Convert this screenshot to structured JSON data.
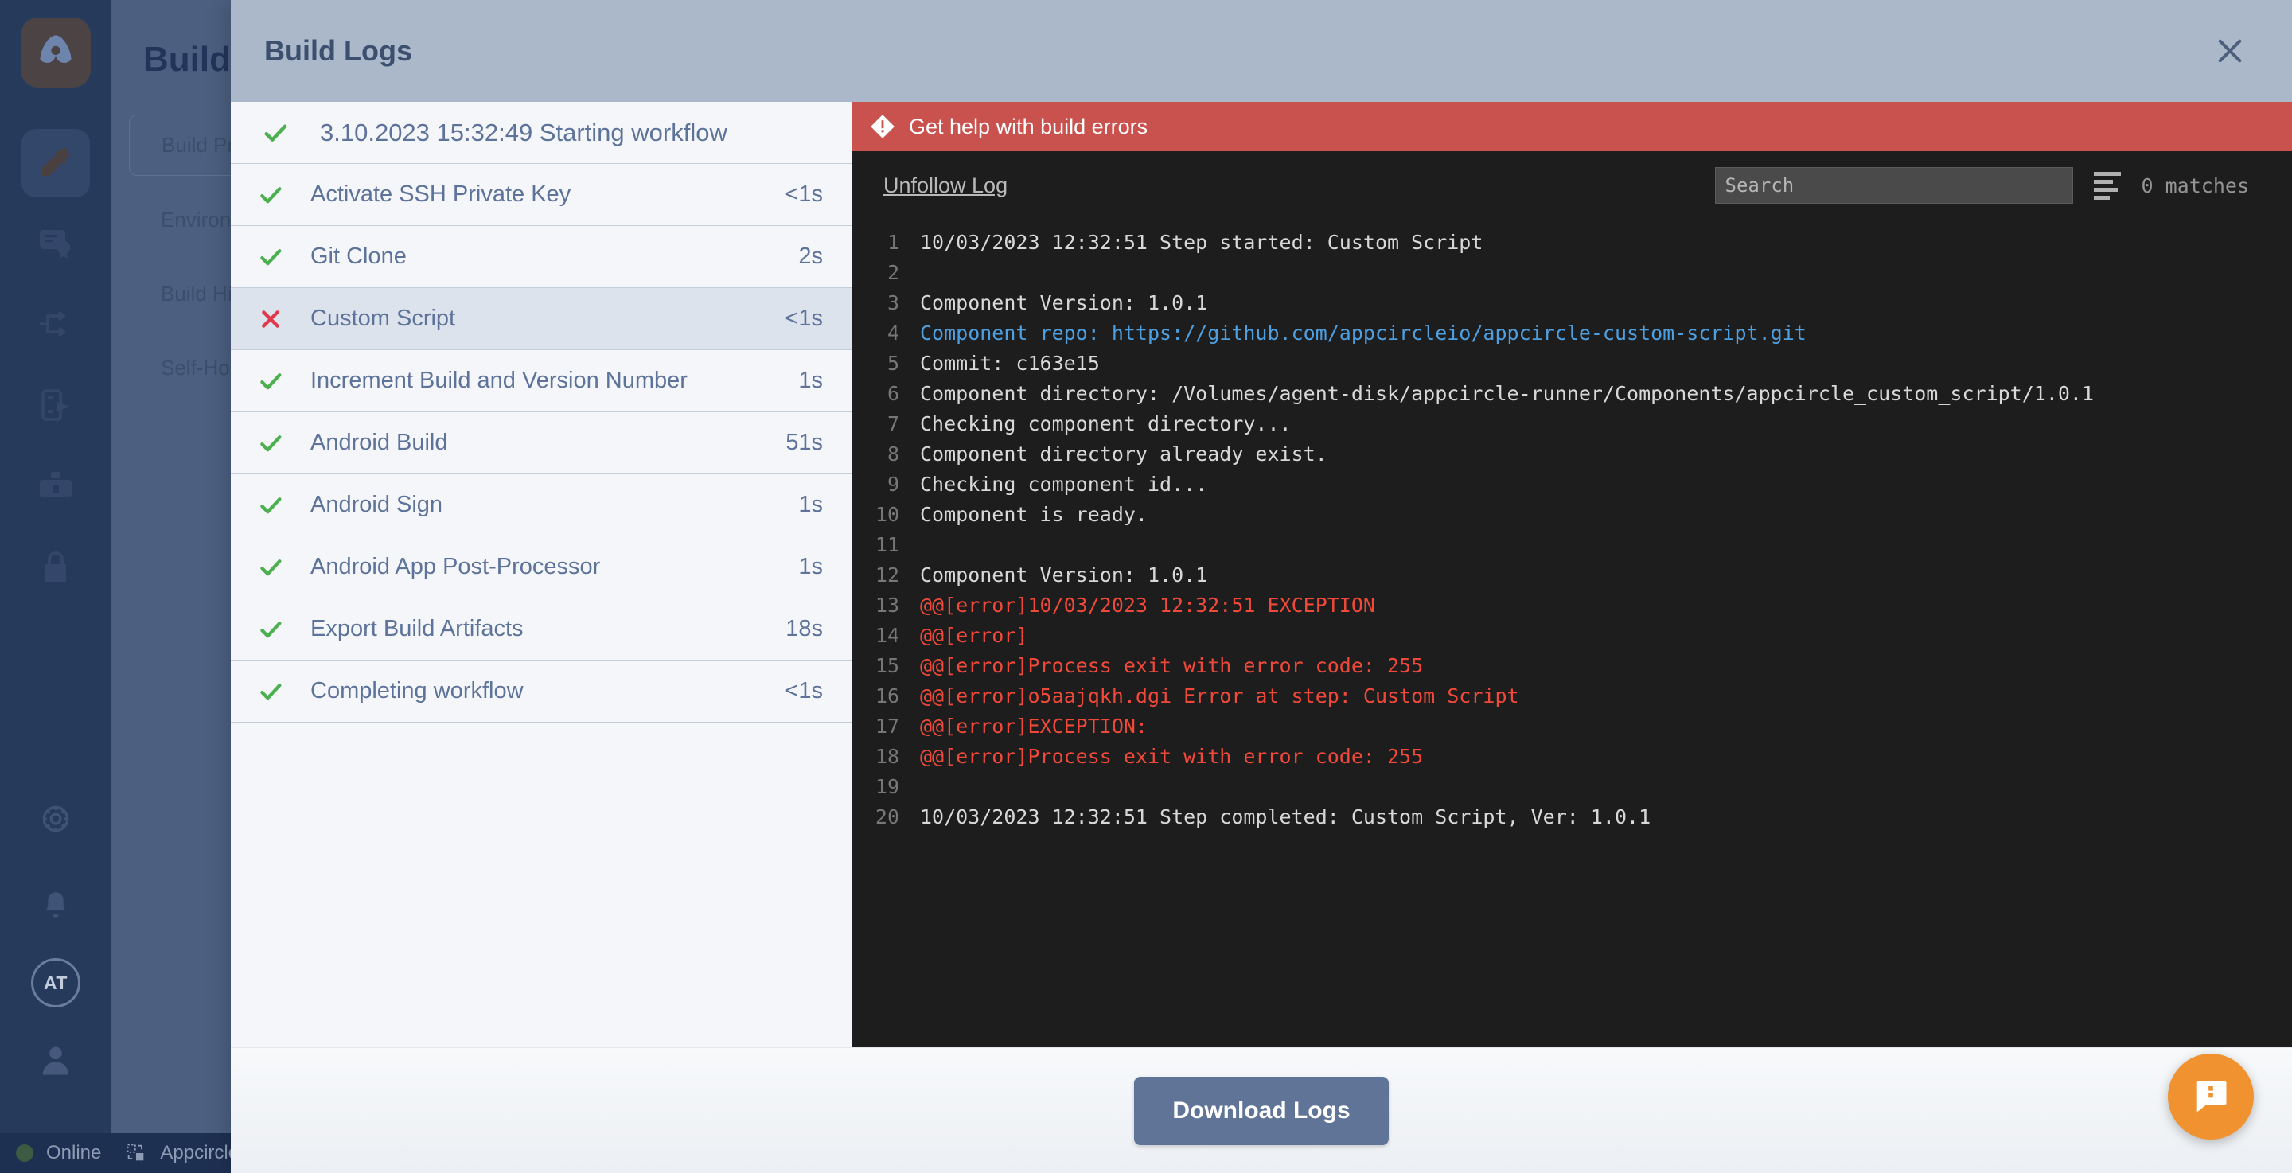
{
  "app": {
    "rail": {
      "logo_icon": "appcircle-logo-icon",
      "items": [
        {
          "icon": "hammer-icon",
          "active": true
        },
        {
          "icon": "certificate-icon",
          "active": false
        },
        {
          "icon": "distribute-icon",
          "active": false
        },
        {
          "icon": "testing-distribution-icon",
          "active": false
        },
        {
          "icon": "enterprise-store-icon",
          "active": false
        },
        {
          "icon": "lock-icon",
          "active": false
        }
      ],
      "bottom_items": [
        {
          "icon": "settings-gear-icon"
        },
        {
          "icon": "notification-bell-icon"
        }
      ],
      "avatar_initials": "AT",
      "profile_icon": "user-circle-icon"
    },
    "status_bar": {
      "connection_label": "Online",
      "connection_color": "#3d5a43",
      "org_icon": "appcircle-mark-icon",
      "org_label": "Appcircle"
    },
    "secondary_nav": {
      "title": "Build",
      "items": [
        {
          "label": "Build Profiles",
          "active": true
        },
        {
          "label": "Environment Variables",
          "active": false
        },
        {
          "label": "Build History",
          "active": false
        },
        {
          "label": "Self-Hosted Runners",
          "active": false
        }
      ]
    }
  },
  "modal": {
    "title": "Build Logs",
    "close_icon": "close-icon",
    "workflow_header": {
      "status": "ok",
      "status_icon": "check-icon",
      "label": "3.10.2023 15:32:49 Starting workflow",
      "duration": ""
    },
    "steps": [
      {
        "status": "ok",
        "status_icon": "check-icon",
        "label": "Activate SSH Private Key",
        "duration": "<1s",
        "selected": false
      },
      {
        "status": "ok",
        "status_icon": "check-icon",
        "label": "Git Clone",
        "duration": "2s",
        "selected": false
      },
      {
        "status": "bad",
        "status_icon": "cross-icon",
        "label": "Custom Script",
        "duration": "<1s",
        "selected": true
      },
      {
        "status": "ok",
        "status_icon": "check-icon",
        "label": "Increment Build and Version Number",
        "duration": "1s",
        "selected": false
      },
      {
        "status": "ok",
        "status_icon": "check-icon",
        "label": "Android Build",
        "duration": "51s",
        "selected": false
      },
      {
        "status": "ok",
        "status_icon": "check-icon",
        "label": "Android Sign",
        "duration": "1s",
        "selected": false
      },
      {
        "status": "ok",
        "status_icon": "check-icon",
        "label": "Android App Post-Processor",
        "duration": "1s",
        "selected": false
      },
      {
        "status": "ok",
        "status_icon": "check-icon",
        "label": "Export Build Artifacts",
        "duration": "18s",
        "selected": false
      },
      {
        "status": "ok",
        "status_icon": "check-icon",
        "label": "Completing workflow",
        "duration": "<1s",
        "selected": false
      }
    ],
    "error_banner": {
      "icon": "error-alert-icon",
      "text": "Get help with build errors",
      "color": "#c9524e"
    },
    "log_toolbar": {
      "follow_toggle_label": "Unfollow Log",
      "search_placeholder": "Search",
      "search_value": "",
      "wrap_icon": "text-wrap-icon",
      "matches_label": "0 matches"
    },
    "log_lines": [
      {
        "n": "1",
        "text": "10/03/2023 12:32:51 Step started: Custom Script",
        "kind": "plain"
      },
      {
        "n": "2",
        "text": "",
        "kind": "plain"
      },
      {
        "n": "3",
        "text": "Component Version: 1.0.1",
        "kind": "plain"
      },
      {
        "n": "4",
        "text": "Component repo: https://github.com/appcircleio/appcircle-custom-script.git",
        "kind": "link"
      },
      {
        "n": "5",
        "text": "Commit: c163e15",
        "kind": "plain"
      },
      {
        "n": "6",
        "text": "Component directory: /Volumes/agent-disk/appcircle-runner/Components/appcircle_custom_script/1.0.1",
        "kind": "plain"
      },
      {
        "n": "7",
        "text": "Checking component directory...",
        "kind": "plain"
      },
      {
        "n": "8",
        "text": "Component directory already exist.",
        "kind": "plain"
      },
      {
        "n": "9",
        "text": "Checking component id...",
        "kind": "plain"
      },
      {
        "n": "10",
        "text": "Component is ready.",
        "kind": "plain"
      },
      {
        "n": "11",
        "text": "",
        "kind": "plain"
      },
      {
        "n": "12",
        "text": "Component Version: 1.0.1",
        "kind": "plain"
      },
      {
        "n": "13",
        "text": "@@[error]10/03/2023 12:32:51 EXCEPTION",
        "kind": "error"
      },
      {
        "n": "14",
        "text": "@@[error]",
        "kind": "error"
      },
      {
        "n": "15",
        "text": "@@[error]Process exit with error code: 255",
        "kind": "error"
      },
      {
        "n": "16",
        "text": "@@[error]o5aajqkh.dgi Error at step: Custom Script",
        "kind": "error"
      },
      {
        "n": "17",
        "text": "@@[error]EXCEPTION:",
        "kind": "error"
      },
      {
        "n": "18",
        "text": "@@[error]Process exit with error code: 255",
        "kind": "error"
      },
      {
        "n": "19",
        "text": "",
        "kind": "plain"
      },
      {
        "n": "20",
        "text": "10/03/2023 12:32:51 Step completed: Custom Script, Ver: 1.0.1",
        "kind": "plain"
      }
    ],
    "footer": {
      "download_label": "Download Logs"
    }
  },
  "fab": {
    "icon": "chat-support-icon",
    "color": "#f0922f"
  }
}
